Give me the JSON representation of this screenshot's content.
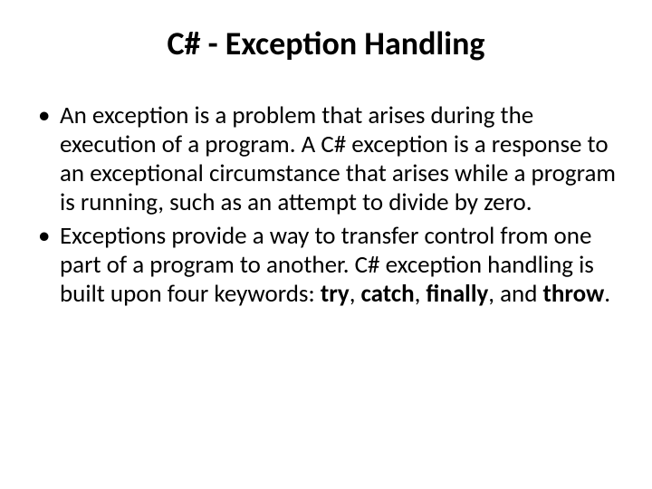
{
  "slide": {
    "title": "C# - Exception Handling",
    "bullets": [
      {
        "text": "An exception is a problem that arises during the execution of a program. A C# exception is a response to an exceptional circumstance that arises while a program is running, such as an attempt to divide by zero."
      },
      {
        "prefix": "Exceptions provide a way to transfer control from one part of a program to another. C# exception handling is built upon four keywords: ",
        "kw1": "try",
        "sep1": ", ",
        "kw2": "catch",
        "sep2": ", ",
        "kw3": "finally",
        "sep3": ", and ",
        "kw4": "throw",
        "suffix": "."
      }
    ]
  }
}
